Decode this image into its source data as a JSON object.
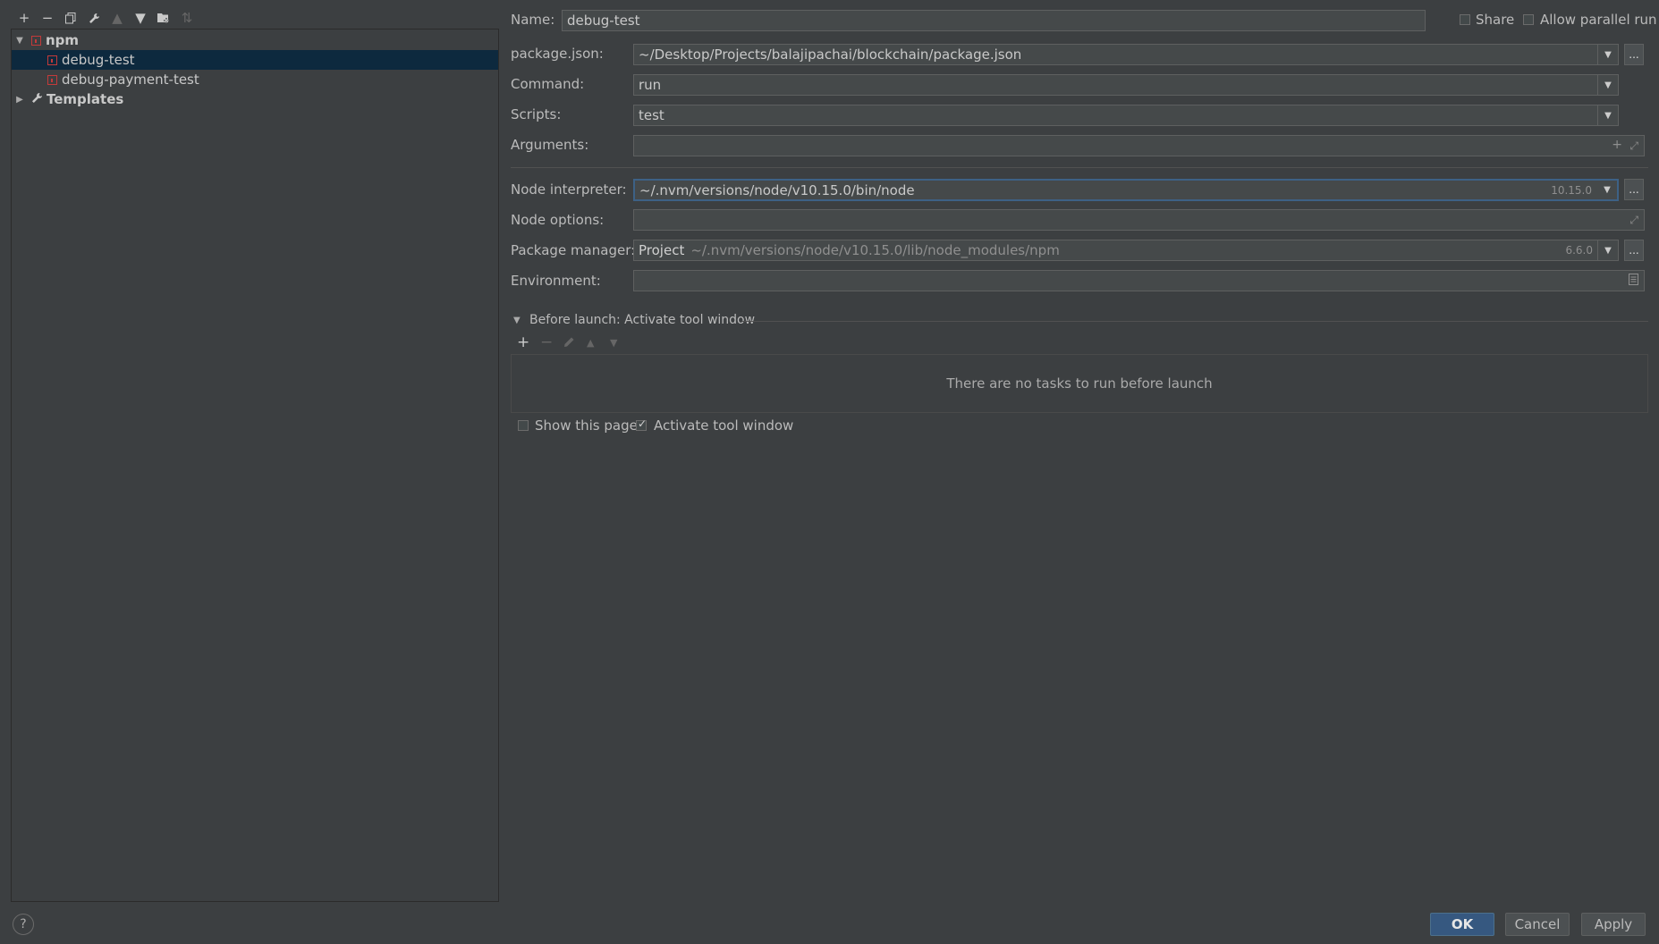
{
  "toolbar": {
    "icons": [
      "plus-icon",
      "minus-icon",
      "copy-icon",
      "wrench-icon",
      "arrow-up-icon",
      "arrow-down-icon",
      "folder-add-icon",
      "sort-icon"
    ]
  },
  "tree": {
    "npm_label": "npm",
    "items": [
      {
        "label": "debug-test",
        "selected": true
      },
      {
        "label": "debug-payment-test",
        "selected": false
      }
    ],
    "templates_label": "Templates"
  },
  "form": {
    "name_label": "Name:",
    "name_value": "debug-test",
    "share_label": "Share",
    "allow_parallel_label": "Allow parallel run",
    "package_json_label": "package.json:",
    "package_json_value": "~/Desktop/Projects/balajipachai/blockchain/package.json",
    "command_label": "Command:",
    "command_value": "run",
    "scripts_label": "Scripts:",
    "scripts_value": "test",
    "arguments_label": "Arguments:",
    "arguments_value": "",
    "node_interpreter_label": "Node interpreter:",
    "node_interpreter_value": "~/.nvm/versions/node/v10.15.0/bin/node",
    "node_version": "10.15.0",
    "node_options_label": "Node options:",
    "node_options_value": "",
    "package_manager_label": "Package manager:",
    "package_manager_project": "Project",
    "package_manager_path": "~/.nvm/versions/node/v10.15.0/lib/node_modules/npm",
    "package_manager_version": "6.6.0",
    "environment_label": "Environment:",
    "environment_value": "",
    "browse_label": "..."
  },
  "before_launch": {
    "title": "Before launch: Activate tool window",
    "empty_text": "There are no tasks to run before launch",
    "show_page_label": "Show this page",
    "show_page_checked": false,
    "activate_label": "Activate tool window",
    "activate_checked": true
  },
  "buttons": {
    "help": "?",
    "ok": "OK",
    "cancel": "Cancel",
    "apply": "Apply"
  },
  "colors": {
    "background": "#3c3f41",
    "selection": "#0d293e",
    "primary_button": "#365880",
    "focus_border": "#3d6185",
    "npm_red": "#c33a3a"
  }
}
